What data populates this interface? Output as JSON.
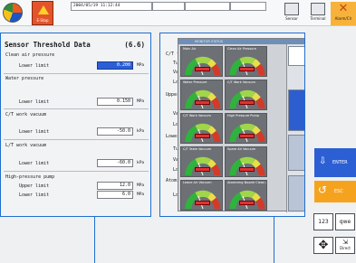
{
  "topbar": {
    "timestamp": "2004/05/19 11:12:44",
    "estop_label": "E-Stop",
    "sensor_label": "Sensor",
    "terminal_label": "Terminal",
    "alarm_label": "Alarm/Clr"
  },
  "left_panel": {
    "title": "Sensor Threshold Data",
    "page_index": "(6.6)",
    "rows": [
      {
        "header": "Clean air pressure",
        "limit_label": "Lower limit",
        "value": "0.200",
        "unit": "MPa",
        "selected": true
      },
      {
        "header": "Water pressure",
        "limit_label": "Lower limit",
        "value": "0.150",
        "unit": "MPa",
        "selected": false
      },
      {
        "header": "C/T work vacuum",
        "limit_label": "Lower limit",
        "value": "-50.0",
        "unit": "kPa",
        "selected": false
      },
      {
        "header": "L/T work vacuum",
        "limit_label": "Lower limit",
        "value": "-60.0",
        "unit": "kPa",
        "selected": false
      }
    ],
    "pump": {
      "header": "High-pressure pump",
      "upper_label": "Upper limit",
      "upper_value": "12.0",
      "lower_label": "Lower limit",
      "lower_value": "6.0",
      "unit": "MPa"
    }
  },
  "right_panel": {
    "labels": [
      "C/T tabl",
      "Turpo",
      "Vacuu",
      "Lower",
      "Upper ai",
      "Vacuu",
      "Lower",
      "Lower ai",
      "Turpo",
      "Vacuu",
      "Lower",
      "Atomizin",
      "Lower"
    ],
    "overlay_title": "MONITOR STATUS",
    "gauges": [
      {
        "title": "Main Air"
      },
      {
        "title": "Clean Air Pressure"
      },
      {
        "title": "Water Pressure"
      },
      {
        "title": "C/T Work Vacuum"
      },
      {
        "title": "C/T Work Vacuum"
      },
      {
        "title": "High Pressure Pump"
      },
      {
        "title": "C/T Table Vacuum"
      },
      {
        "title": "Spare Air Vacuum"
      },
      {
        "title": "Leave Air Vacuum"
      },
      {
        "title": "Atomizing Nozzle Clean Air Pressure"
      }
    ]
  },
  "tools": {
    "enter_label": "ENTER",
    "esc_label": "ESC",
    "numkey_label": "123",
    "textkey_label": "qwe",
    "direct_label": "Direct"
  }
}
